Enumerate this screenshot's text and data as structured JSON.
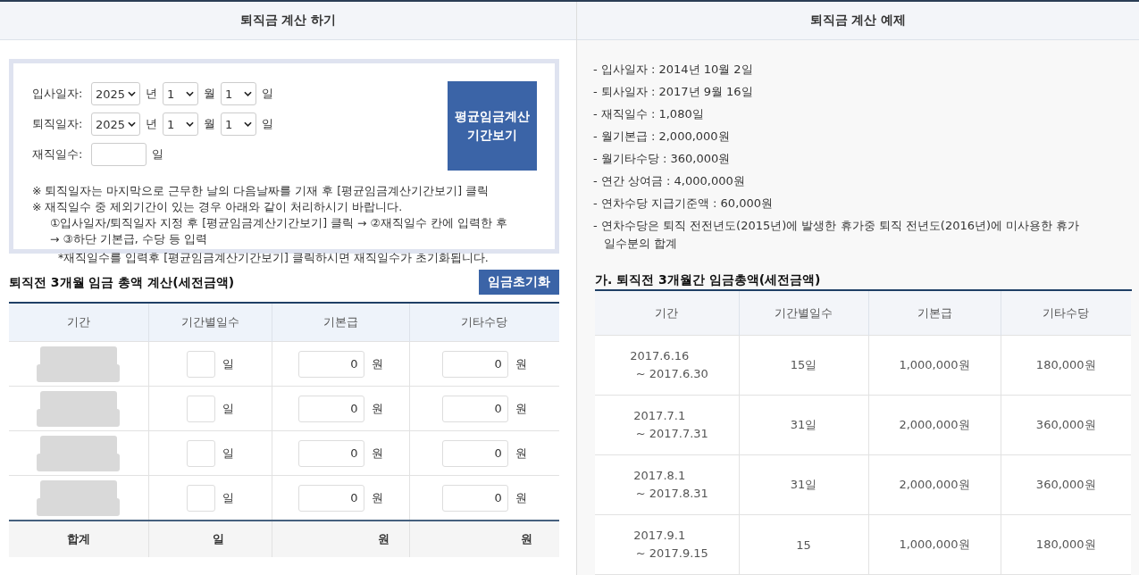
{
  "left": {
    "title": "퇴직금 계산 하기",
    "date_rows": [
      {
        "label": "입사일자:",
        "year": "2025",
        "year_unit": "년",
        "month": "1",
        "month_unit": "월",
        "day": "1",
        "day_unit": "일"
      },
      {
        "label": "퇴직일자:",
        "year": "2025",
        "year_unit": "년",
        "month": "1",
        "month_unit": "월",
        "day": "1",
        "day_unit": "일"
      }
    ],
    "days_row": {
      "label": "재직일수:",
      "unit": "일"
    },
    "period_button": "평균임금계산 기간보기",
    "notes": [
      {
        "kind": "note",
        "text": "※ 퇴직일자는 마지막으로 근무한 날의 다음날짜를 기재 후 [평균임금계산기간보기] 클릭"
      },
      {
        "kind": "note",
        "text": "※ 재직일수 중 제외기간이 있는 경우 아래와 같이 처리하시기 바랍니다."
      },
      {
        "kind": "step",
        "text": "①입사일자/퇴직일자 지정 후 [평균임금계산기간보기] 클릭 → ②재직일수 칸에 입력한 후"
      },
      {
        "kind": "step",
        "text": "→ ③하단 기본급, 수당 등 입력"
      },
      {
        "kind": "footnote",
        "text": "*재직일수를 입력후 [평균임금계산기간보기] 클릭하시면 재직일수가 초기화됩니다."
      }
    ],
    "section_title": "퇴직전 3개월 임금 총액 계산(세전금액)",
    "reset_button": "임금초기화",
    "table": {
      "columns": [
        "기간",
        "기간별일수",
        "기본급",
        "기타수당"
      ],
      "rows": [
        {
          "day_unit": "일",
          "base": "0",
          "base_unit": "원",
          "other": "0",
          "other_unit": "원"
        },
        {
          "day_unit": "일",
          "base": "0",
          "base_unit": "원",
          "other": "0",
          "other_unit": "원"
        },
        {
          "day_unit": "일",
          "base": "0",
          "base_unit": "원",
          "other": "0",
          "other_unit": "원"
        },
        {
          "day_unit": "일",
          "base": "0",
          "base_unit": "원",
          "other": "0",
          "other_unit": "원"
        }
      ],
      "total": {
        "label": "합계",
        "day_unit": "일",
        "base_unit": "원",
        "other_unit": "원"
      }
    }
  },
  "right": {
    "title": "퇴직금 계산 예제",
    "items": [
      "- 입사일자 : 2014년 10월 2일",
      "- 퇴사일자 : 2017년 9월 16일",
      "- 재직일수 : 1,080일",
      "- 월기본급 : 2,000,000원",
      "- 월기타수당 : 360,000원",
      "- 연간 상여금 : 4,000,000원",
      "- 연차수당 지급기준액 : 60,000원",
      "- 연차수당은 퇴직 전전년도(2015년)에 발생한 휴가중 퇴직 전년도(2016년)에 미사용한 휴가 일수분의 합계"
    ],
    "section_title": "가. 퇴직전 3개월간 임금총액(세전금액)",
    "table": {
      "columns": [
        "기간",
        "기간별일수",
        "기본급",
        "기타수당"
      ],
      "rows": [
        {
          "period": [
            "2017.6.16",
            "~ 2017.6.30"
          ],
          "days": "15일",
          "base": "1,000,000원",
          "other": "180,000원"
        },
        {
          "period": [
            "2017.7.1",
            "~ 2017.7.31"
          ],
          "days": "31일",
          "base": "2,000,000원",
          "other": "360,000원"
        },
        {
          "period": [
            "2017.8.1",
            "~ 2017.8.31"
          ],
          "days": "31일",
          "base": "2,000,000원",
          "other": "360,000원"
        },
        {
          "period": [
            "2017.9.1",
            "~ 2017.9.15"
          ],
          "days": "15",
          "base": "1,000,000원",
          "other": "180,000원"
        }
      ]
    }
  }
}
